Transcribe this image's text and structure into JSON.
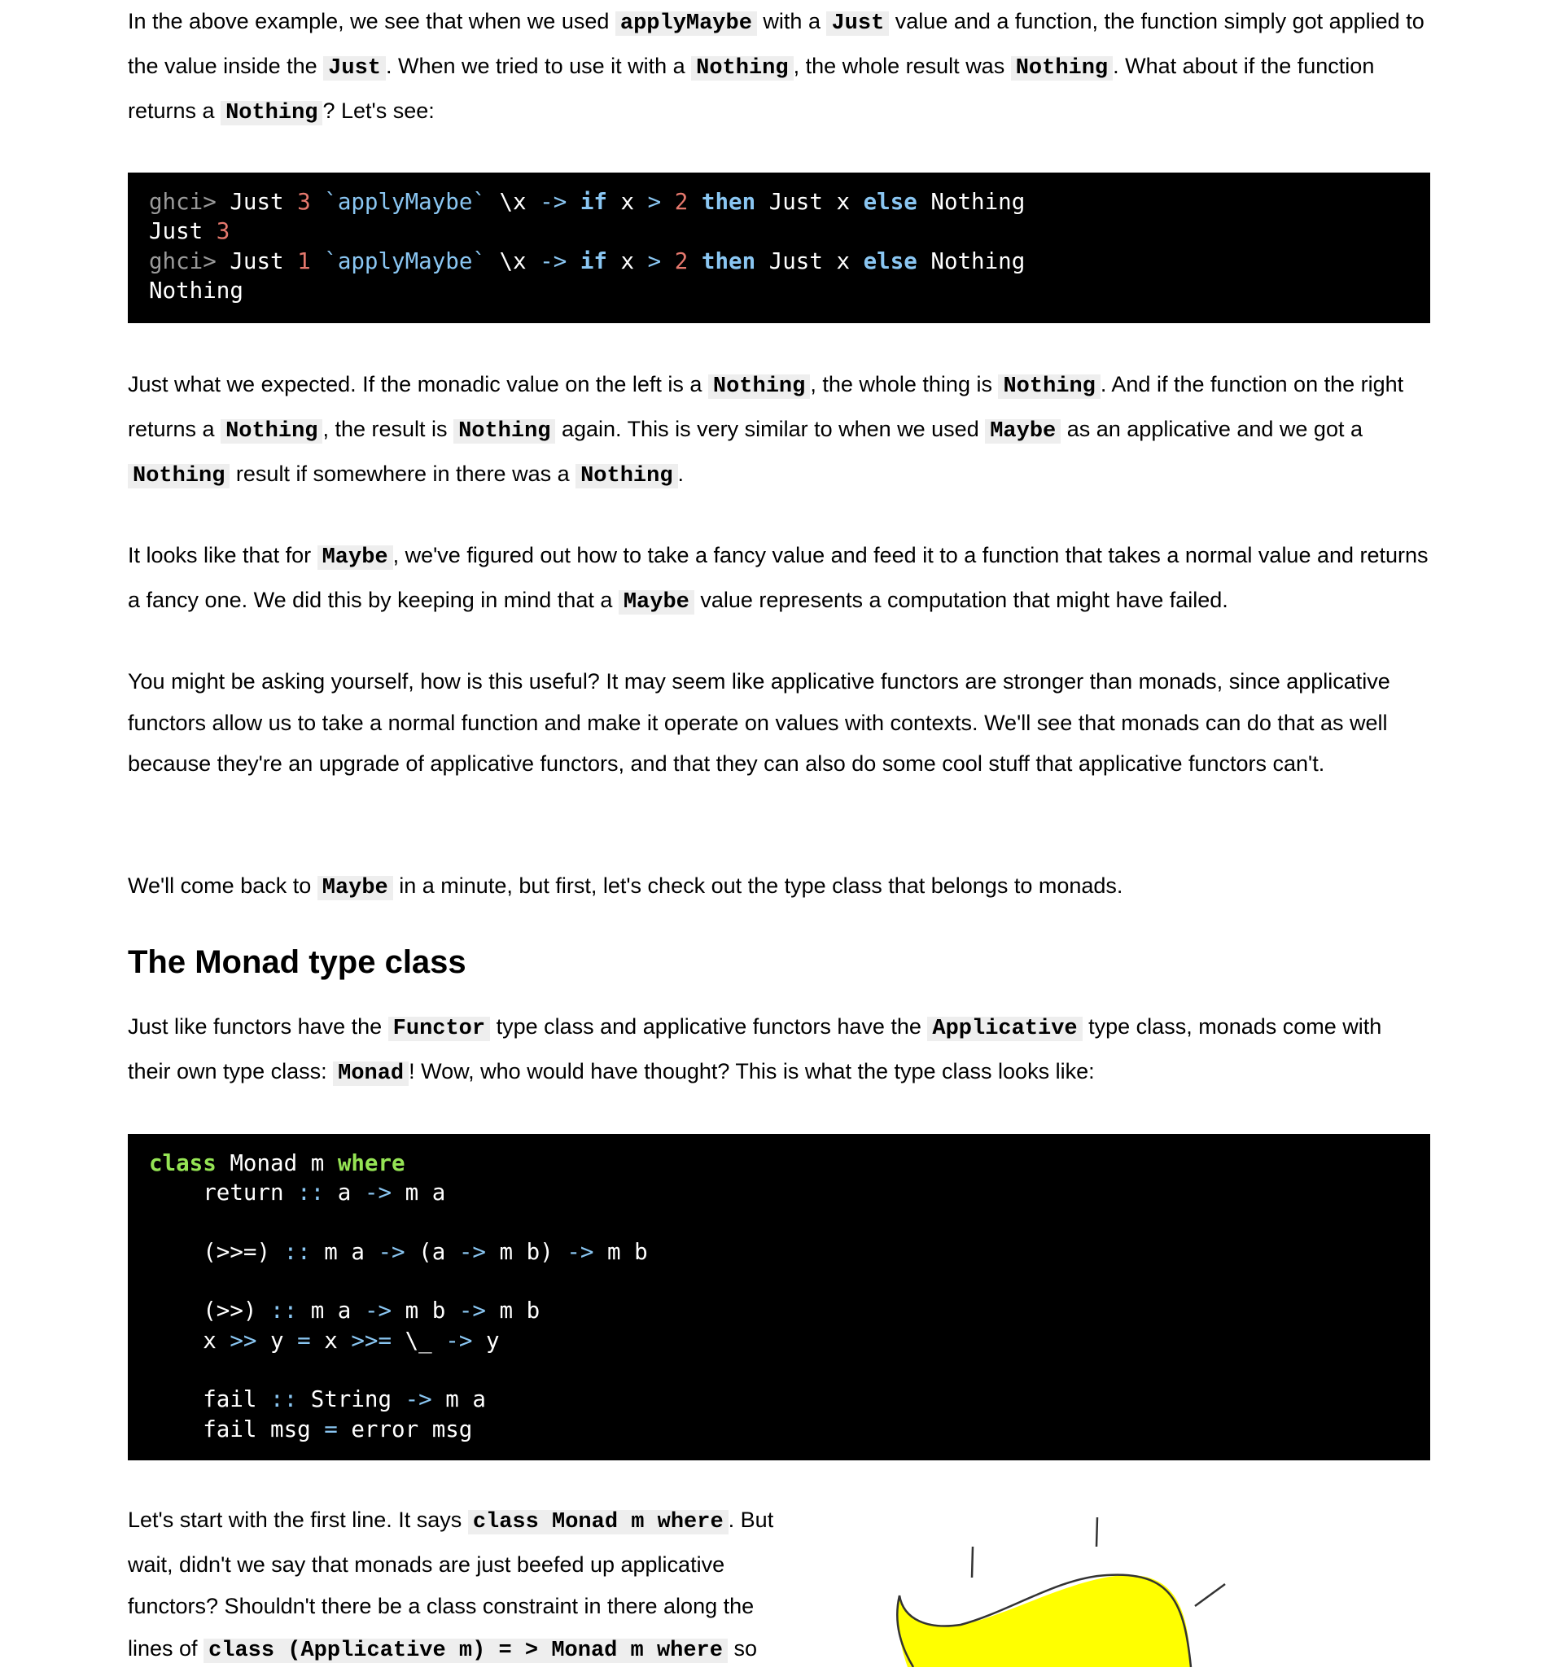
{
  "paragraphs": [
    [
      {
        "t": "In the above example, we see that when we used "
      },
      {
        "c": "applyMaybe"
      },
      {
        "t": " with a "
      },
      {
        "c": "Just"
      },
      {
        "t": " value and a function, the function simply got applied to the value inside the "
      },
      {
        "c": "Just"
      },
      {
        "t": ". When we tried to use it with a "
      },
      {
        "c": "Nothing"
      },
      {
        "t": ", the whole result was "
      },
      {
        "c": "Nothing"
      },
      {
        "t": ". What about if the function returns a "
      },
      {
        "c": "Nothing"
      },
      {
        "t": "? Let's see:"
      }
    ],
    [
      {
        "t": "Just what we expected. If the monadic value on the left is a "
      },
      {
        "c": "Nothing"
      },
      {
        "t": ", the whole thing is "
      },
      {
        "c": "Nothing"
      },
      {
        "t": ". And if the function on the right returns a "
      },
      {
        "c": "Nothing"
      },
      {
        "t": ", the result is "
      },
      {
        "c": "Nothing"
      },
      {
        "t": " again. This is very similar to when we used "
      },
      {
        "c": "Maybe"
      },
      {
        "t": " as an applicative and we got a "
      },
      {
        "c": "Nothing"
      },
      {
        "t": " result if somewhere in there was a "
      },
      {
        "c": "Nothing"
      },
      {
        "t": "."
      }
    ],
    [
      {
        "t": "It looks like that for "
      },
      {
        "c": "Maybe"
      },
      {
        "t": ", we've figured out how to take a fancy value and feed it to a function that takes a normal value and returns a fancy one. We did this by keeping in mind that a "
      },
      {
        "c": "Maybe"
      },
      {
        "t": " value represents a computation that might have failed."
      }
    ],
    [
      {
        "t": "You might be asking yourself, how is this useful? It may seem like applicative functors are stronger than monads, since applicative functors allow us to take a normal function and make it operate on values with contexts. We'll see that monads can do that as well because they're an upgrade of applicative functors, and that they can also do some cool stuff that applicative functors can't."
      }
    ],
    [
      {
        "t": "We'll come back to "
      },
      {
        "c": "Maybe"
      },
      {
        "t": " in a minute, but first, let's check out the type class that belongs to monads."
      }
    ],
    [
      {
        "t": "Just like functors have the "
      },
      {
        "c": "Functor"
      },
      {
        "t": " type class and applicative functors have the "
      },
      {
        "c": "Applicative"
      },
      {
        "t": " type class, monads come with their own type class: "
      },
      {
        "c": "Monad"
      },
      {
        "t": "! Wow, who would have thought? This is what the type class looks like:"
      }
    ],
    [
      {
        "t": "Let's start with the first line. It says "
      },
      {
        "c": "class Monad m where"
      },
      {
        "t": ". But wait, didn't we say that monads are just beefed up applicative functors? Shouldn't there be a class constraint in there along the lines of "
      },
      {
        "c": "class (Applicative m) = > Monad m where"
      },
      {
        "t": " so"
      }
    ]
  ],
  "heading": "The Monad type class",
  "code_blocks": [
    [
      [
        [
          "prompt",
          "ghci> "
        ],
        [
          "txt",
          "Just "
        ],
        [
          "num",
          "3"
        ],
        [
          "fn",
          " `applyMaybe` "
        ],
        [
          "txt",
          "\\x "
        ],
        [
          "op",
          "->"
        ],
        [
          "txt",
          " "
        ],
        [
          "kw",
          "if"
        ],
        [
          "txt",
          " x "
        ],
        [
          "op",
          ">"
        ],
        [
          "txt",
          " "
        ],
        [
          "num",
          "2"
        ],
        [
          "txt",
          " "
        ],
        [
          "kw",
          "then"
        ],
        [
          "txt",
          " Just x "
        ],
        [
          "kw",
          "else"
        ],
        [
          "txt",
          " Nothing"
        ]
      ],
      [
        [
          "txt",
          "Just "
        ],
        [
          "num",
          "3"
        ]
      ],
      [
        [
          "prompt",
          "ghci> "
        ],
        [
          "txt",
          "Just "
        ],
        [
          "num",
          "1"
        ],
        [
          "fn",
          " `applyMaybe` "
        ],
        [
          "txt",
          "\\x "
        ],
        [
          "op",
          "->"
        ],
        [
          "txt",
          " "
        ],
        [
          "kw",
          "if"
        ],
        [
          "txt",
          " x "
        ],
        [
          "op",
          ">"
        ],
        [
          "txt",
          " "
        ],
        [
          "num",
          "2"
        ],
        [
          "txt",
          " "
        ],
        [
          "kw",
          "then"
        ],
        [
          "txt",
          " Just x "
        ],
        [
          "kw",
          "else"
        ],
        [
          "txt",
          " Nothing"
        ]
      ],
      [
        [
          "txt",
          "Nothing"
        ]
      ]
    ],
    [
      [
        [
          "kw2",
          "class"
        ],
        [
          "txt",
          " Monad m "
        ],
        [
          "kw2",
          "where"
        ]
      ],
      [
        [
          "txt",
          "    return "
        ],
        [
          "op",
          "::"
        ],
        [
          "txt",
          " a "
        ],
        [
          "op",
          "->"
        ],
        [
          "txt",
          " m a"
        ]
      ],
      [
        [
          "txt",
          ""
        ]
      ],
      [
        [
          "txt",
          "    (>>=) "
        ],
        [
          "op",
          "::"
        ],
        [
          "txt",
          " m a "
        ],
        [
          "op",
          "->"
        ],
        [
          "txt",
          " (a "
        ],
        [
          "op",
          "->"
        ],
        [
          "txt",
          " m b) "
        ],
        [
          "op",
          "->"
        ],
        [
          "txt",
          " m b"
        ]
      ],
      [
        [
          "txt",
          ""
        ]
      ],
      [
        [
          "txt",
          "    (>>) "
        ],
        [
          "op",
          "::"
        ],
        [
          "txt",
          " m a "
        ],
        [
          "op",
          "->"
        ],
        [
          "txt",
          " m b "
        ],
        [
          "op",
          "->"
        ],
        [
          "txt",
          " m b"
        ]
      ],
      [
        [
          "txt",
          "    x "
        ],
        [
          "op",
          ">>"
        ],
        [
          "txt",
          " y "
        ],
        [
          "op",
          "="
        ],
        [
          "txt",
          " x "
        ],
        [
          "op",
          ">>="
        ],
        [
          "txt",
          " \\_ "
        ],
        [
          "op",
          "->"
        ],
        [
          "txt",
          " y"
        ]
      ],
      [
        [
          "txt",
          ""
        ]
      ],
      [
        [
          "txt",
          "    fail "
        ],
        [
          "op",
          "::"
        ],
        [
          "txt",
          " String "
        ],
        [
          "op",
          "->"
        ],
        [
          "txt",
          " m a"
        ]
      ],
      [
        [
          "txt",
          "    fail msg "
        ],
        [
          "op",
          "="
        ],
        [
          "txt",
          " error msg"
        ]
      ]
    ]
  ],
  "illustration": {
    "fill": "#ffff00",
    "stroke": "#333333"
  }
}
